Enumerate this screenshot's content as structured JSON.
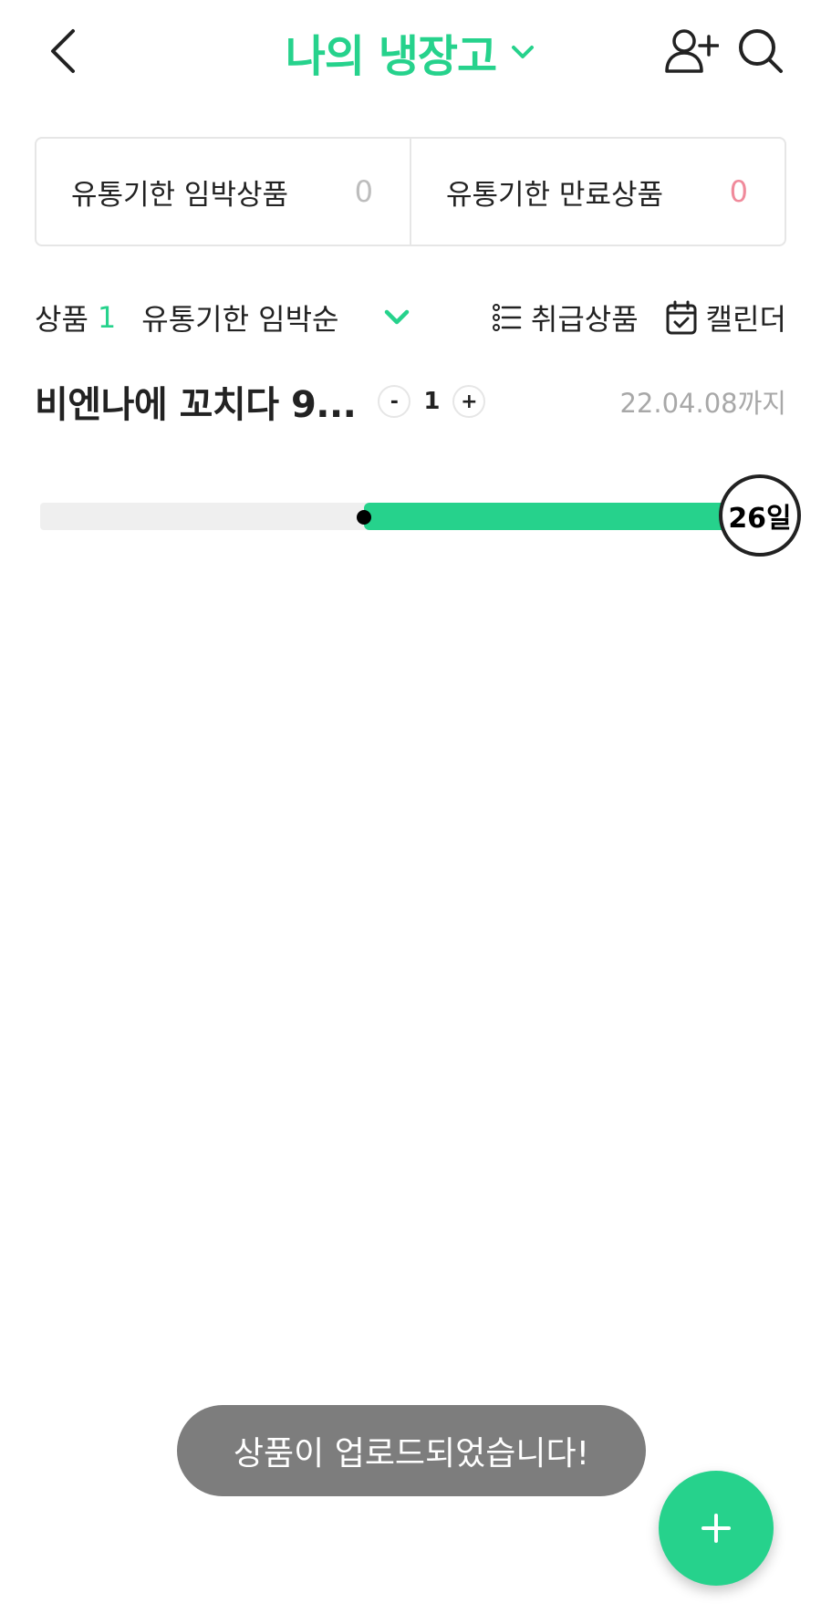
{
  "header": {
    "title": "나의 냉장고",
    "back_icon": "chevron-left-icon",
    "title_dropdown_icon": "chevron-down-icon",
    "add_user_icon": "add-user-icon",
    "search_icon": "search-icon"
  },
  "summary": {
    "imminent_label": "유통기한 임박상품",
    "imminent_count": "0",
    "expired_label": "유통기한 만료상품",
    "expired_count": "0"
  },
  "filter": {
    "count_label": "상품",
    "count_value": "1",
    "sort_label": "유통기한 임박순",
    "sort_dropdown_icon": "chevron-down-icon",
    "manage_icon": "list-icon",
    "manage_label": "취급상품",
    "calendar_icon": "calendar-check-icon",
    "calendar_label": "캘린더"
  },
  "products": [
    {
      "name": "비엔나에 꼬치다 9...",
      "quantity": "1",
      "decrement_label": "-",
      "increment_label": "+",
      "expiry": "22.04.08까지",
      "days_left": "26일",
      "progress_start_fraction": 0.455
    }
  ],
  "toast": {
    "message": "상품이 업로드되었습니다!"
  },
  "fab": {
    "icon": "plus-icon"
  },
  "colors": {
    "accent": "#26d28c",
    "expired_count": "#f08a9b",
    "muted_text": "#a8a8a8",
    "track": "#efefef",
    "toast_bg": "#7d7d7d"
  }
}
